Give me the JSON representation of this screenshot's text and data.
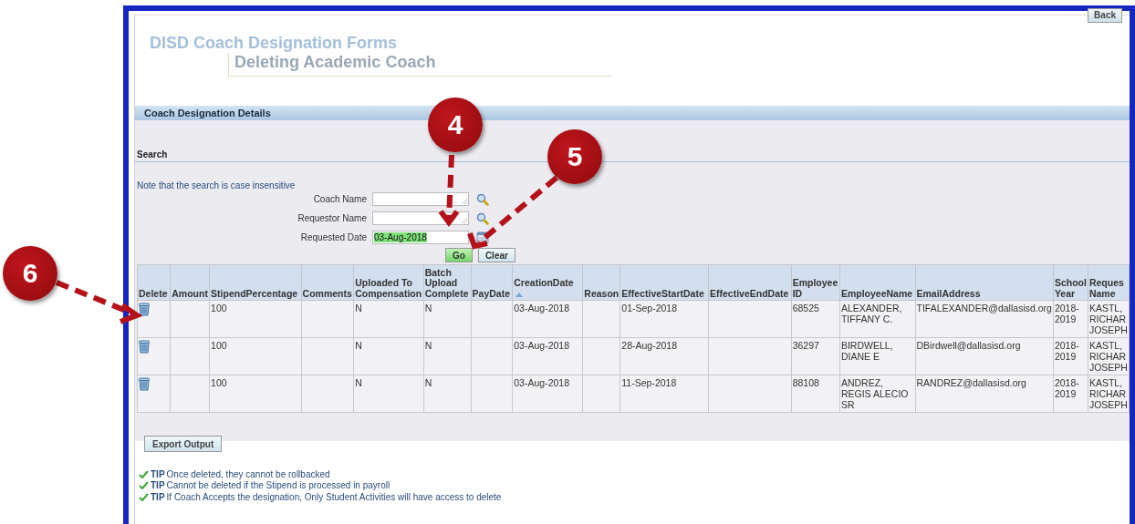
{
  "header": {
    "back_button": "Back",
    "title": "DISD Coach Designation Forms",
    "subtitle": "Deleting Academic Coach"
  },
  "section": {
    "title": "Coach Designation Details"
  },
  "search": {
    "title": "Search",
    "note": "Note that the search is case insensitive",
    "fields": [
      {
        "label": "Coach Name",
        "kind": "lookup"
      },
      {
        "label": "Requestor Name",
        "kind": "lookup"
      },
      {
        "label": "Requested Date",
        "kind": "date",
        "value": "03-Aug-2018",
        "highlighted": true
      }
    ],
    "buttons": [
      {
        "label": "Go",
        "primary": true
      },
      {
        "label": "Clear",
        "primary": false
      }
    ]
  },
  "table": {
    "columns": [
      {
        "label": "Delete"
      },
      {
        "label": "Amount"
      },
      {
        "label": "StipendPercentage"
      },
      {
        "label": "Comments"
      },
      {
        "label": "Uploaded To Compensation"
      },
      {
        "label": "Batch Upload Complete"
      },
      {
        "label": "PayDate"
      },
      {
        "label": "CreationDate",
        "sorted": true
      },
      {
        "label": "Reason"
      },
      {
        "label": "EffectiveStartDate"
      },
      {
        "label": "EffectiveEndDate"
      },
      {
        "label": "Employee ID"
      },
      {
        "label": "EmployeeName"
      },
      {
        "label": "EmailAddress"
      },
      {
        "label": "School Year"
      },
      {
        "label": "Reques Name"
      }
    ],
    "rows": [
      {
        "cells": [
          null,
          null,
          "100",
          null,
          "N",
          "N",
          null,
          "03-Aug-2018",
          null,
          "01-Sep-2018",
          null,
          "68525",
          "ALEXANDER, TIFFANY C.",
          "TIFALEXANDER@dallasisd.org",
          "2018-2019",
          "KASTL, RICHAR JOSEPH"
        ]
      },
      {
        "cells": [
          null,
          null,
          "100",
          null,
          "N",
          "N",
          null,
          "03-Aug-2018",
          null,
          "28-Aug-2018",
          null,
          "36297",
          "BIRDWELL, DIANE E",
          "DBirdwell@dallasisd.org",
          "2018-2019",
          "KASTL, RICHAR JOSEPH"
        ]
      },
      {
        "cells": [
          null,
          null,
          "100",
          null,
          "N",
          "N",
          null,
          "03-Aug-2018",
          null,
          "11-Sep-2018",
          null,
          "88108",
          "ANDREZ, REGIS ALECIO SR",
          "RANDREZ@dallasisd.org",
          "2018-2019",
          "KASTL, RICHAR JOSEPH"
        ]
      }
    ]
  },
  "export_button": "Export Output",
  "tips": [
    {
      "label": "TIP",
      "text": "Once deleted, they cannot be rollbacked"
    },
    {
      "label": "TIP",
      "text": "Cannot be deleted if the Stipend is processed in payroll"
    },
    {
      "label": "TIP",
      "text": "If Coach Accepts the designation, Only Student Activities will have access to delete"
    }
  ],
  "callouts": [
    {
      "number": "4"
    },
    {
      "number": "5"
    },
    {
      "number": "6"
    }
  ]
}
